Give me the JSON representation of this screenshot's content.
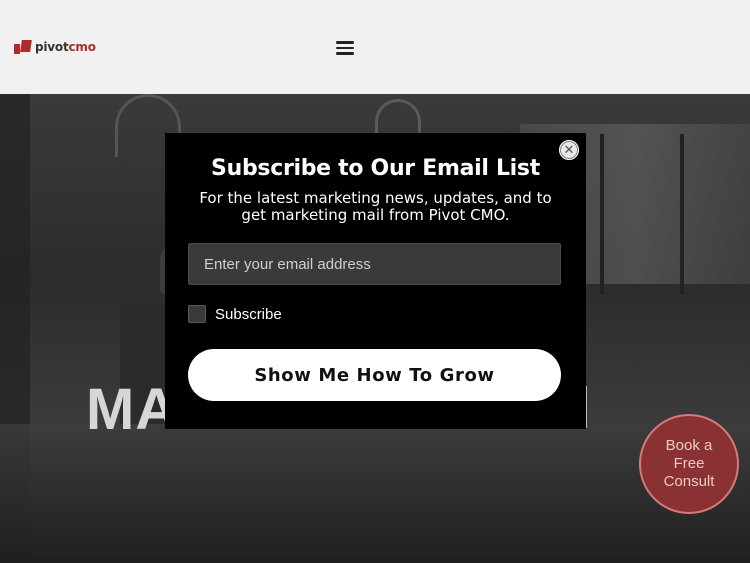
{
  "header": {
    "logo_prefix": "pivot",
    "logo_accent": "cmo",
    "menu_icon": "hamburger-menu-icon"
  },
  "hero": {
    "heading_fragment": "MA"
  },
  "popup": {
    "title": "Subscribe to Our Email List",
    "subtitle": "For the latest marketing news, updates, and to get marketing mail from Pivot CMO.",
    "email_placeholder": "Enter your email address",
    "email_value": "",
    "checkbox_label": "Subscribe",
    "checkbox_checked": false,
    "button_label": "Show Me How To Grow",
    "close_symbol": "✕"
  },
  "consult": {
    "label": "Book a Free Consult"
  },
  "colors": {
    "brand_red": "#b02a2a",
    "popup_bg": "#000000",
    "consult_bg": "#8a3233"
  }
}
